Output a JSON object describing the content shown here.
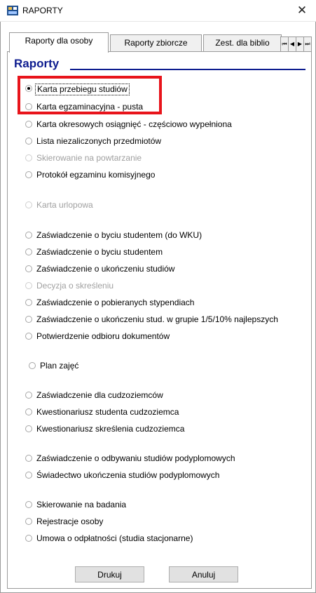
{
  "window": {
    "title": "RAPORTY",
    "close_glyph": "✕"
  },
  "tabs": [
    {
      "label": "Raporty dla osoby",
      "active": true
    },
    {
      "label": "Raporty zbiorcze",
      "active": false
    },
    {
      "label": "Zest. dla biblio",
      "active": false
    }
  ],
  "tab_scroll": {
    "first": "⏮",
    "prev": "◀",
    "next": "▶",
    "last": "⏭"
  },
  "section": {
    "heading": "Raporty"
  },
  "reports": [
    {
      "label": "Karta przebiegu studiów",
      "selected": true,
      "enabled": true
    },
    {
      "label": "Karta egzaminacyjna - pusta",
      "selected": false,
      "enabled": true
    },
    {
      "label": "Karta okresowych osiągnięć - częściowo wypełniona",
      "selected": false,
      "enabled": true
    },
    {
      "label": "Lista niezaliczonych przedmiotów",
      "selected": false,
      "enabled": true
    },
    {
      "label": "Skierowanie na powtarzanie",
      "selected": false,
      "enabled": false
    },
    {
      "label": "Protokół egzaminu komisyjnego",
      "selected": false,
      "enabled": true
    },
    {
      "label": "Karta urlopowa",
      "selected": false,
      "enabled": false
    },
    {
      "label": "Zaświadczenie o byciu studentem (do WKU)",
      "selected": false,
      "enabled": true
    },
    {
      "label": "Zaświadczenie o byciu studentem",
      "selected": false,
      "enabled": true
    },
    {
      "label": "Zaświadczenie o ukończeniu studiów",
      "selected": false,
      "enabled": true
    },
    {
      "label": "Decyzja o skreśleniu",
      "selected": false,
      "enabled": false
    },
    {
      "label": "Zaświadczenie o pobieranych stypendiach",
      "selected": false,
      "enabled": true
    },
    {
      "label": "Zaświadczenie o ukończeniu stud. w grupie 1/5/10% najlepszych",
      "selected": false,
      "enabled": true
    },
    {
      "label": "Potwierdzenie odbioru dokumentów",
      "selected": false,
      "enabled": true
    },
    {
      "label": "Plan zajęć",
      "selected": false,
      "enabled": true
    },
    {
      "label": "Zaświadczenie dla cudzoziemców",
      "selected": false,
      "enabled": true
    },
    {
      "label": "Kwestionariusz studenta cudzoziemca",
      "selected": false,
      "enabled": true
    },
    {
      "label": "Kwestionariusz skreślenia cudzoziemca",
      "selected": false,
      "enabled": true
    },
    {
      "label": "Zaświadczenie o odbywaniu studiów podyplomowych",
      "selected": false,
      "enabled": true
    },
    {
      "label": "Świadectwo ukończenia studiów podyplomowych",
      "selected": false,
      "enabled": true
    },
    {
      "label": "Skierowanie na badania",
      "selected": false,
      "enabled": true
    },
    {
      "label": "Rejestracje osoby",
      "selected": false,
      "enabled": true
    },
    {
      "label": "Umowa o odpłatności (studia stacjonarne)",
      "selected": false,
      "enabled": true
    }
  ],
  "buttons": {
    "print": "Drukuj",
    "cancel": "Anuluj"
  },
  "colors": {
    "heading": "#0d1c8f",
    "highlight": "#e8141b",
    "disabled_text": "#a0a0a0"
  }
}
